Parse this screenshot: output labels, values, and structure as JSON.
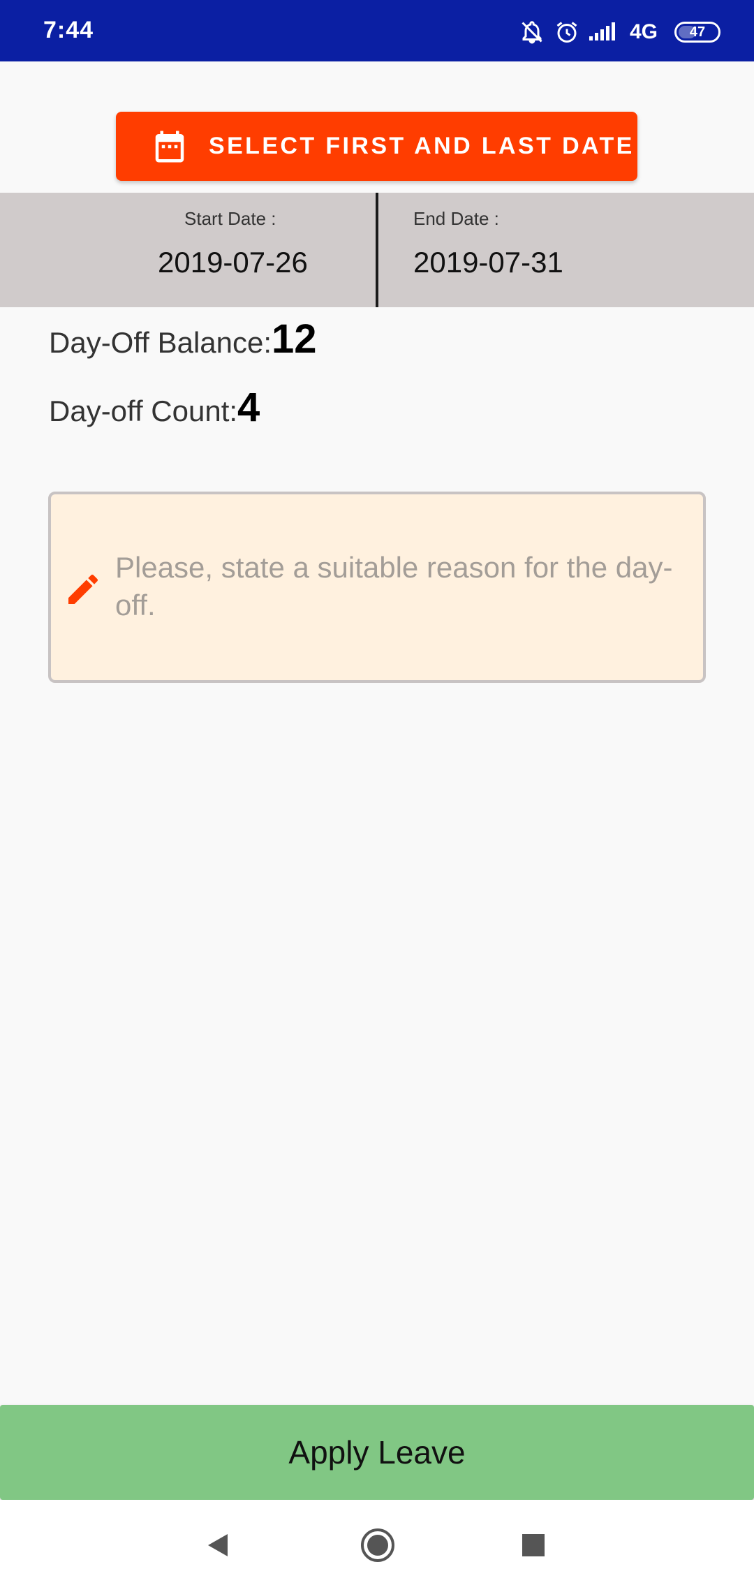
{
  "status_bar": {
    "time": "7:44",
    "network": "4G",
    "network_sub": "",
    "battery": "47",
    "battery_level": 0.47,
    "icons": [
      "bell-off-icon",
      "alarm-icon",
      "signal-icon",
      "battery-icon"
    ]
  },
  "header_button": {
    "label": "SELECT FIRST AND LAST DATE",
    "icon": "calendar-icon",
    "color": "#ff3d00"
  },
  "date_range": {
    "start_caption": "Start Date :",
    "start_value": "2019-07-26",
    "end_caption": "End Date :",
    "end_value": "2019-07-31"
  },
  "leave_info": {
    "balance_label": "Day-Off Balance:",
    "balance_value": "12",
    "count_label": "Day-off Count:",
    "count_value": "4"
  },
  "reason": {
    "placeholder": "Please, state a suitable reason for the day-off.",
    "value": "",
    "icon": "pencil-icon"
  },
  "apply_button": {
    "label": "Apply Leave",
    "color": "#81c784"
  },
  "nav_bar": {
    "icons": [
      "back-icon",
      "home-icon",
      "recents-icon"
    ]
  }
}
